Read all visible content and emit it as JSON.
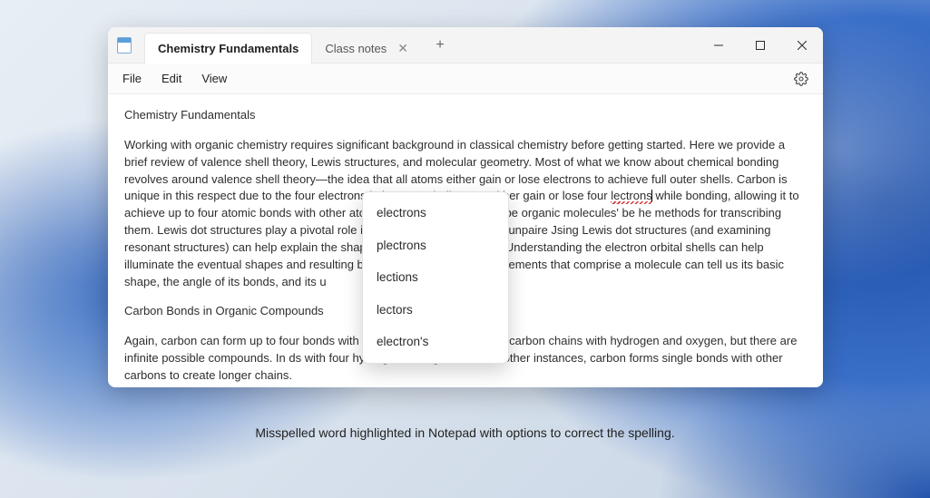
{
  "tabs": [
    {
      "label": "Chemistry Fundamentals",
      "active": true
    },
    {
      "label": "Class notes",
      "active": false
    }
  ],
  "menu": {
    "file": "File",
    "edit": "Edit",
    "view": "View"
  },
  "document": {
    "title": "Chemistry Fundamentals",
    "para1_a": "Working with organic chemistry requires significant background in classical chemistry before getting started. Here we provide a brief review of valence shell theory, Lewis structures, and molecular geometry. Most of what we know about chemical bonding revolves around valence shell theory—the idea that all atoms either gain or lose electrons to achieve full outer shells. Carbon is unique in this respect due to the four electrons in its outer shell. It can either gain or lose four ",
    "misspelled": "lectrons",
    "para1_b": " while bonding, allowing it to achieve up to four atomic bonds with other atoms or molecules. To describe organic molecules' be                                                              he methods for transcribing them. Lewis dot structures play a pivotal role in describing the paired and unpaire                                                             Jsing Lewis dot structures (and examining resonant structures) can help explain the shapes and bonding p                                                              pounds. Understanding the electron orbital shells can help illuminate the eventual shapes and resulting bonds in                                                              ving the chemical elements that comprise a molecule can tell us its basic shape, the angle of its bonds, and its u",
    "heading2": "Carbon Bonds in Organic Compounds",
    "para2": "Again, carbon can form up to four bonds with other m                                                               we mainly focus on carbon chains with hydrogen and oxygen, but there are infinite possible compounds. In                                                              ds with four hydrogen in single bonds. In other instances, carbon forms single bonds with other carbons to create longer chains."
  },
  "suggestions": [
    "electrons",
    "plectrons",
    "lections",
    "lectors",
    "electron's"
  ],
  "caption": "Misspelled word highlighted in Notepad with options to correct the spelling."
}
